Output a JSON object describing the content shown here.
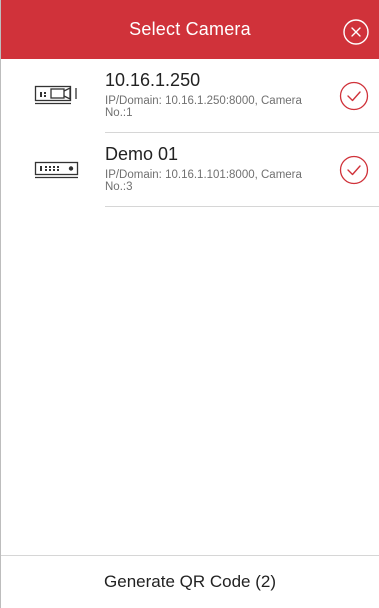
{
  "header": {
    "title": "Select Camera",
    "close_icon": "close-circle-icon",
    "background_color": "#d0323a"
  },
  "cameras": [
    {
      "name": "10.16.1.250",
      "detail": "IP/Domain: 10.16.1.250:8000, Camera No.:1",
      "device_icon": "camera-device-icon",
      "selected": true
    },
    {
      "name": "Demo 01",
      "detail": "IP/Domain: 10.16.1.101:8000, Camera No.:3",
      "device_icon": "recorder-device-icon",
      "selected": true
    }
  ],
  "footer": {
    "generate_label": "Generate QR Code (2)"
  },
  "colors": {
    "accent": "#d0323a",
    "check": "#d0323a"
  }
}
